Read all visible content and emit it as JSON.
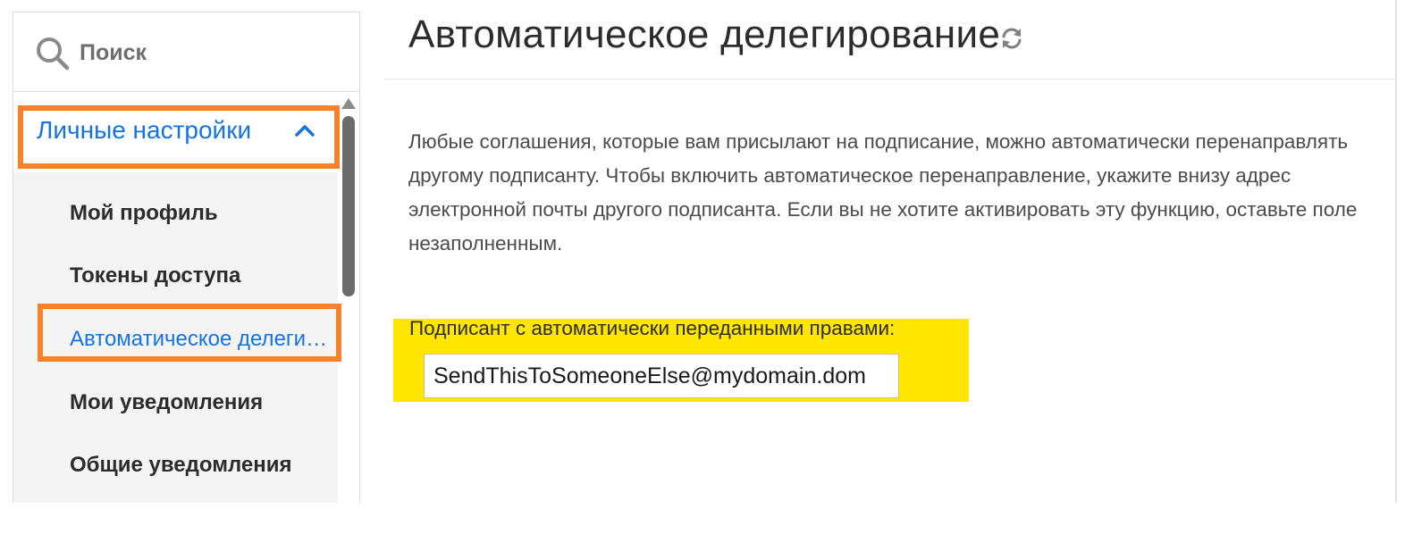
{
  "search": {
    "placeholder": "Поиск"
  },
  "sidebar": {
    "section_label": "Личные настройки",
    "items": [
      {
        "label": "Мой профиль"
      },
      {
        "label": "Токены доступа"
      },
      {
        "label": "Автоматическое делеги…"
      },
      {
        "label": "Мои уведомления"
      },
      {
        "label": "Общие уведомления"
      }
    ]
  },
  "main": {
    "title": "Автоматическое делегирование",
    "description": "Любые соглашения, которые вам присылают на подписание, можно автоматически перенаправлять другому подписанту. Чтобы включить автоматическое перенаправление, укажите внизу адрес электронной почты другого подписанта. Если вы не хотите активировать эту функцию, оставьте поле незаполненным.",
    "delegate_label": "Подписант с автоматически переданными правами:",
    "delegate_value": "SendThisToSomeoneElse@mydomain.dom"
  },
  "colors": {
    "accent": "#1473e6",
    "highlight_orange": "#f5822a",
    "highlight_yellow": "#ffe600"
  },
  "icons": {
    "search": "search-icon",
    "section_toggle": "chevron-up-icon",
    "refresh": "refresh-icon"
  }
}
